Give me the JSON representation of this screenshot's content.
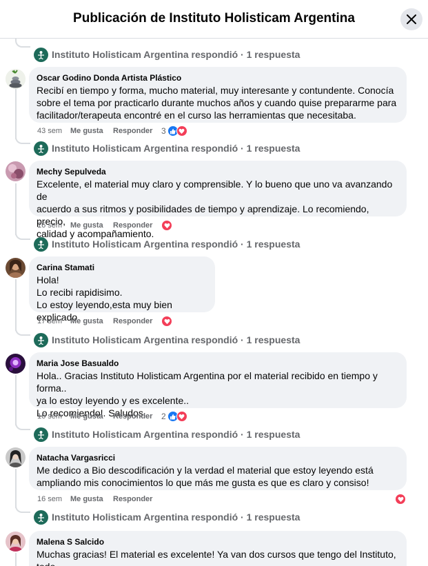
{
  "header": {
    "title": "Publicación de Instituto Holisticam Argentina"
  },
  "reply_summary": "Instituto Holisticam Argentina respondió · 1 respuesta",
  "comments": [
    {
      "author": "Oscar Godino Donda Artista Plástico",
      "text": "Recibí en tiempo y forma, mucho material, muy interesante y contundente. Conocía\nsobre el tema por practicarlo durante muchos años y cuando quise prepararme para\nfacilitador/terapeuta encontré en el curso las herramientas que necesitaba.",
      "time": "43 sem",
      "like": "Me gusta",
      "reply": "Responder",
      "reaction_count": "3"
    },
    {
      "author": "Mechy Sepulveda",
      "text": "Excelente, el material muy claro y comprensible. Y lo bueno que uno va avanzando de\nacuerdo a sus ritmos y posibilidades de tiempo y aprendizaje. Lo recomiendo, precio,\ncalidad y acompañamiento.",
      "time": "16 sem",
      "like": "Me gusta",
      "reply": "Responder",
      "reaction_count": ""
    },
    {
      "author": "Carina Stamati",
      "text": "Hola!\nLo recibi rapidisimo.\nLo estoy leyendo,esta muy bien explicado",
      "time": "17 sem",
      "like": "Me gusta",
      "reply": "Responder",
      "reaction_count": ""
    },
    {
      "author": "Maria Jose Basualdo",
      "text": "Hola.. Gracias Instituto Holisticam Argentina por el material recibido en tiempo y forma..\nya lo estoy leyendo y es excelente..\nLo recomiendo!. Saludos.",
      "time": "16 sem",
      "like": "Me gusta",
      "reply": "Responder",
      "reaction_count": "2"
    },
    {
      "author": "Natacha Vargasricci",
      "text": "Me dedico a Bio descodificación y la verdad el material que estoy leyendo está\nampliando mis conocimientos lo que más me gusta es que es claro y consiso!",
      "time": "16 sem",
      "like": "Me gusta",
      "reply": "Responder",
      "reaction_count": ""
    },
    {
      "author": "Malena S Salcido",
      "text": "Muchas gracias! El material es excelente! Ya van dos cursos que tengo del Instituto, todo",
      "time": "",
      "like": "",
      "reply": "",
      "reaction_count": ""
    }
  ],
  "colors": {
    "like": "#1877f2",
    "love": "#f33e58",
    "bubble": "#f0f2f5",
    "muted": "#65676b",
    "page_logo": "#1e6b5a"
  }
}
